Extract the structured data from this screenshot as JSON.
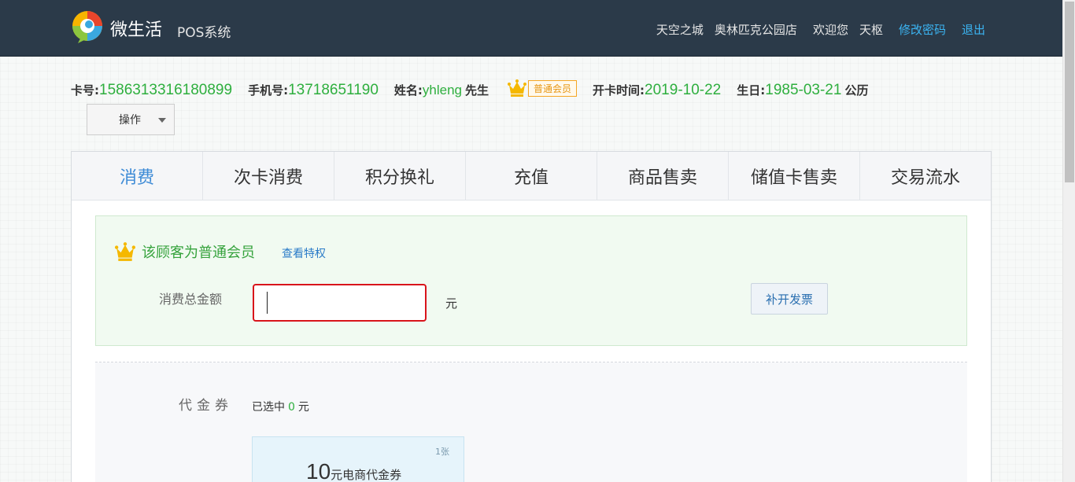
{
  "header": {
    "brand": "微生活",
    "system": "POS系统",
    "area": "天空之城",
    "store": "奥林匹克公园店",
    "welcome": "欢迎您",
    "username": "天枢",
    "change_password": "修改密码",
    "logout": "退出",
    "colors": {
      "bar": "#2b3a49",
      "link": "#3bb4f2"
    }
  },
  "member": {
    "card_label": "卡号:",
    "card_no": "1586313316180899",
    "phone_label": "手机号:",
    "phone": "13718651190",
    "name_label": "姓名:",
    "name": "yhleng",
    "title": "先生",
    "level_badge": "普通会员",
    "open_label": "开卡时间:",
    "open_date": "2019-10-22",
    "birthday_label": "生日:",
    "birthday": "1985-03-21",
    "calendar": "公历",
    "value_color": "#2eaf3e"
  },
  "operations": {
    "label": "操作"
  },
  "tabs": [
    {
      "label": "消费",
      "active": true
    },
    {
      "label": "次卡消费"
    },
    {
      "label": "积分换礼"
    },
    {
      "label": "充值"
    },
    {
      "label": "商品售卖"
    },
    {
      "label": "储值卡售卖"
    },
    {
      "label": "交易流水"
    }
  ],
  "consume": {
    "member_notice": "该顾客为普通会员",
    "view_privileges": "查看特权",
    "amount_label": "消费总金额",
    "amount_value": "",
    "unit": "元",
    "invoice_button": "补开发票"
  },
  "voucher": {
    "label": "代金券",
    "selected_prefix": "已选中",
    "selected_count": "0",
    "selected_unit": "元",
    "cards": [
      {
        "count": "1张",
        "amount": "10",
        "name": "元电商代金券"
      }
    ]
  }
}
